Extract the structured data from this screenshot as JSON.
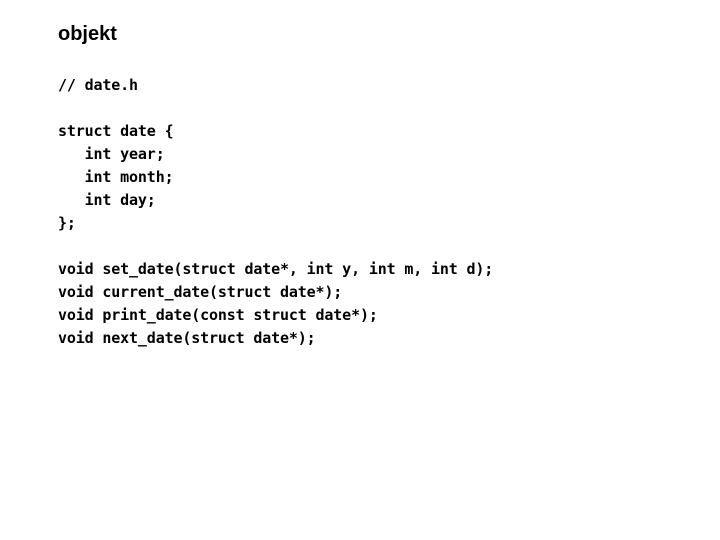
{
  "slide": {
    "title": "objekt",
    "background_color": "#ffffff",
    "text_color": "#000000"
  },
  "code": {
    "language": "c",
    "filename_comment": "// date.h",
    "blocks": [
      {
        "name": "comment",
        "lines": [
          "// date.h"
        ]
      },
      {
        "name": "struct-definition",
        "lines": [
          "struct date {",
          "   int year;",
          "   int month;",
          "   int day;",
          "};"
        ]
      },
      {
        "name": "function-declarations",
        "lines": [
          "void set_date(struct date*, int y, int m, int d);",
          "void current_date(struct date*);",
          "void print_date(const struct date*);",
          "void next_date(struct date*);"
        ]
      }
    ]
  }
}
